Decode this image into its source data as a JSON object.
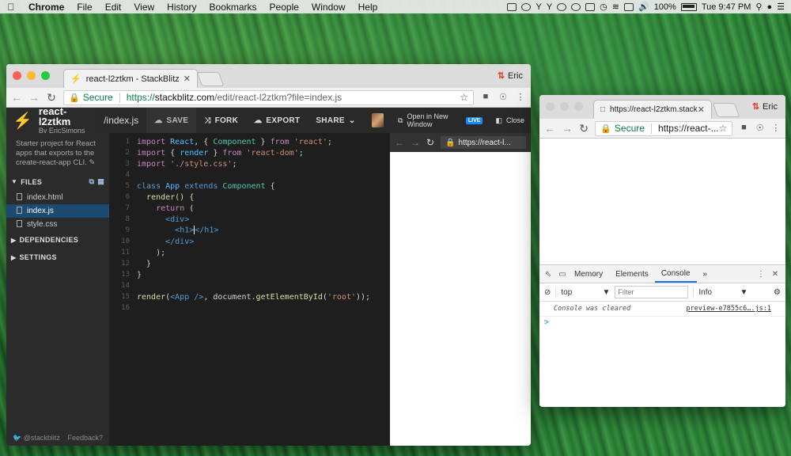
{
  "menubar": {
    "app": "Chrome",
    "items": [
      "File",
      "Edit",
      "View",
      "History",
      "Bookmarks",
      "People",
      "Window",
      "Help"
    ],
    "battery": "100%",
    "clock": "Tue 9:47 PM"
  },
  "main_window": {
    "tab_title": "react-l2ztkm - StackBlitz",
    "profile": "Eric",
    "secure_label": "Secure",
    "url_host": "https://",
    "url_domain": "stackblitz.com",
    "url_path": "/edit/react-l2ztkm?file=index.js"
  },
  "stackblitz": {
    "project_name": "react-l2ztkm",
    "project_by": "By EricSimons",
    "active_file_tab": "/index.js",
    "save": "SAVE",
    "fork": "FORK",
    "export": "EXPORT",
    "share": "SHARE",
    "open_new_window": "Open in New Window",
    "live_badge": "LIVE",
    "close": "Close",
    "description": "Starter project for React apps that exports to the create-react-app CLI.",
    "files_header": "FILES",
    "files": [
      "index.html",
      "index.js",
      "style.css"
    ],
    "dependencies_header": "DEPENDENCIES",
    "settings_header": "SETTINGS",
    "twitter": "@stackblitz",
    "feedback": "Feedback?",
    "preview_url": "https://react-l..."
  },
  "code": {
    "line_numbers": [
      "1",
      "2",
      "3",
      "4",
      "5",
      "6",
      "7",
      "8",
      "9",
      "10",
      "11",
      "12",
      "13",
      "14",
      "15",
      "16"
    ],
    "l1": [
      "import",
      " React",
      ", { ",
      "Component",
      " } ",
      "from",
      " ",
      "'react'",
      ";"
    ],
    "l2": [
      "import",
      " { ",
      "render",
      " } ",
      "from",
      " ",
      "'react-dom'",
      ";"
    ],
    "l3": [
      "import",
      " ",
      "'./style.css'",
      ";"
    ],
    "l5": [
      "class",
      " App",
      " extends",
      " ",
      "Component",
      " {"
    ],
    "l6": "  render() {",
    "l7": [
      "    ",
      "return",
      " ("
    ],
    "l8": [
      "      ",
      "<div>"
    ],
    "l9a": [
      "        ",
      "<h1>"
    ],
    "l9b": "</h1>",
    "l10": [
      "      ",
      "</div>"
    ],
    "l11": "    );",
    "l12": "  }",
    "l13": "}",
    "l15": [
      "render",
      "(",
      "<App />",
      ", document.",
      "getElementById",
      "(",
      "'root'",
      "));"
    ]
  },
  "second_window": {
    "tab_title": "https://react-l2ztkm.stackbli",
    "profile": "Eric",
    "secure_label": "Secure",
    "url": "https://react-...",
    "devtools": {
      "tabs": [
        "Memory",
        "Elements",
        "Console"
      ],
      "more": "»",
      "context": "top",
      "filter_placeholder": "Filter",
      "level": "Info",
      "message": "Console was cleared",
      "source": "preview-e7855c6….js:1",
      "prompt": ">"
    }
  },
  "colors": {
    "stackblitz_blue": "#1389fd",
    "secure_green": "#0b8043",
    "editor_bg": "#1e1e1e"
  }
}
